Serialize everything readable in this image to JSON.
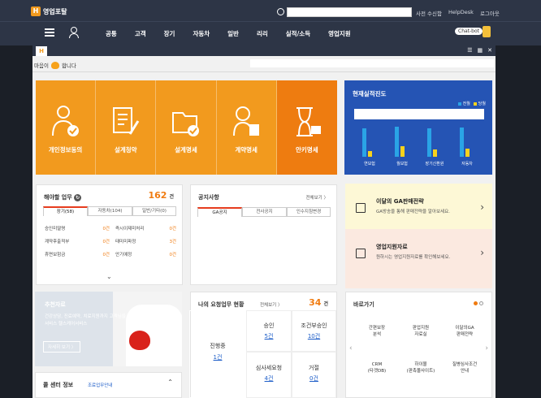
{
  "app": {
    "title": "영업포탈",
    "logo_letter": "H"
  },
  "top_links": [
    "사전 수신함",
    "HelpDesk",
    "로그아웃"
  ],
  "menu": [
    "공통",
    "고객",
    "장기",
    "자동차",
    "일반",
    "리리",
    "실적/소득",
    "영업지원"
  ],
  "chatbot": "Chat-bot",
  "greeting": {
    "pre": "마음이",
    "post": "합니다"
  },
  "tiles": [
    "개인정보동의",
    "설계청약",
    "설계명세",
    "계약명세",
    "안키명세"
  ],
  "progress": {
    "title": "현재실적진도",
    "legend": [
      "전월",
      "당월"
    ],
    "bars": [
      {
        "label": "연보험",
        "prev": 0.8,
        "curr": 0.15
      },
      {
        "label": "월보험",
        "prev": 0.85,
        "curr": 0.3
      },
      {
        "label": "장기신환원",
        "prev": 0.8,
        "curr": 0.2
      },
      {
        "label": "자동차",
        "prev": 0.82,
        "curr": 0.22
      }
    ],
    "colors": {
      "prev": "#2aa4e6",
      "curr": "#f7d21c"
    }
  },
  "todo": {
    "title": "해야할 업무",
    "count": "162",
    "unit": "건",
    "tabs": [
      "장기(58)",
      "자동차(104)",
      "일반/기타(0)"
    ],
    "left": [
      [
        "승인미딸명",
        "0건"
      ],
      [
        "계약후출적부",
        "0건"
      ],
      [
        "휴면보험금",
        "0건"
      ]
    ],
    "right": [
      [
        "즉시이제미처리",
        "0건"
      ],
      [
        "태미미파정",
        "3건"
      ],
      [
        "안기예정",
        "0건"
      ]
    ]
  },
  "notice": {
    "title": "공지사항",
    "more": "전체보기 〉",
    "tabs": [
      "GA공지",
      "전사공지",
      "인수지침변경"
    ]
  },
  "promo1": {
    "title": "이달의 GA판매전략",
    "sub": "GA방송을 통해 판매전략을 알아보세요."
  },
  "promo2": {
    "title": "영업지원자료",
    "sub": "원하시는 영업지원자료를 확인해보세요."
  },
  "recommend": {
    "title": "추천자료",
    "text": "건강상담, 진료예약, 치료지원까지 고객님을 위한 맞춤 헬스케어서비스 헬스케어서비스",
    "button": "자세히 보기 〉"
  },
  "callcenter": {
    "title": "콜 센터 정보",
    "link": "조료업무안내"
  },
  "request": {
    "title": "나의 요청업무 현황",
    "more": "전체보기 〉",
    "count": "34",
    "unit": "건",
    "cells": [
      {
        "label": "승인",
        "val": "5건"
      },
      {
        "label": "조건부승인",
        "val": "10건"
      },
      {
        "label": "진행중",
        "val": "1건"
      },
      {
        "label": "심사세요청",
        "val": "4건"
      },
      {
        "label": "거절",
        "val": "0건"
      }
    ]
  },
  "shortcut": {
    "title": "바로가기",
    "items": [
      "간편보장\n분석",
      "판업지원\n자료실",
      "이달의GA\n판매전략",
      "CRM\n(타겟DB)",
      "하이몰\n(판촉몰사이트)",
      "질병심사조건\n안내"
    ]
  }
}
